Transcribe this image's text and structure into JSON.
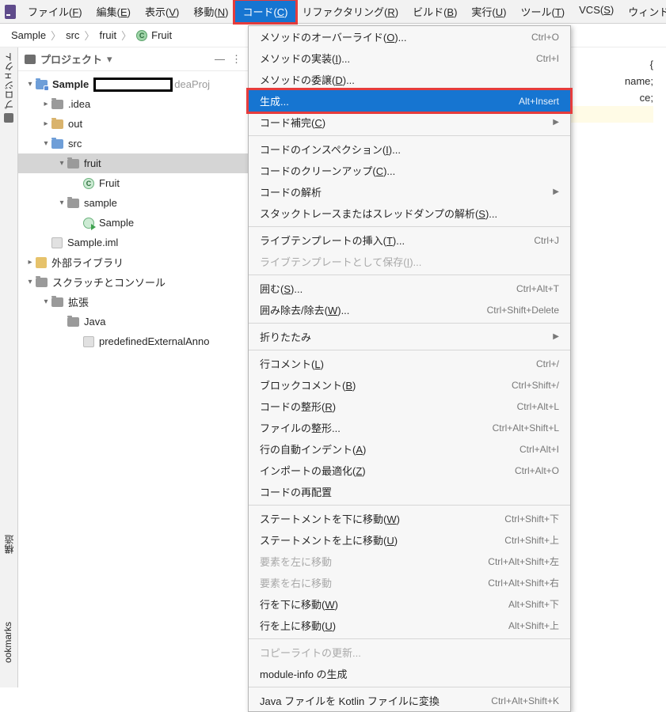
{
  "menubar": {
    "items": [
      {
        "label": "ファイル",
        "mn": "F"
      },
      {
        "label": "編集",
        "mn": "E"
      },
      {
        "label": "表示",
        "mn": "V"
      },
      {
        "label": "移動",
        "mn": "N"
      },
      {
        "label": "コード",
        "mn": "C",
        "active": true
      },
      {
        "label": "リファクタリング",
        "mn": "R"
      },
      {
        "label": "ビルド",
        "mn": "B"
      },
      {
        "label": "実行",
        "mn": "U"
      },
      {
        "label": "ツール",
        "mn": "T"
      },
      {
        "label": "VCS",
        "mn": "S"
      },
      {
        "label": "ウィンドウ",
        "mn": "W"
      }
    ]
  },
  "breadcrumb": {
    "parts": [
      "Sample",
      "src",
      "fruit"
    ],
    "className": "Fruit"
  },
  "sidebar_strip": {
    "project": "プロジェクト",
    "structure": "構造",
    "bookmarks": "ookmarks"
  },
  "tree": {
    "title": "プロジェクト",
    "nodes": {
      "sample": "Sample",
      "sample_tail": "deaProj",
      "idea": ".idea",
      "out": "out",
      "src": "src",
      "fruit": "fruit",
      "fruit_class": "Fruit",
      "sample_pkg": "sample",
      "sample_class": "Sample",
      "iml": "Sample.iml",
      "ext_lib": "外部ライブラリ",
      "scratch": "スクラッチとコンソール",
      "ext": "拡張",
      "java": "Java",
      "pred": "predefinedExternalAnno"
    }
  },
  "editor": {
    "line1_frag": "{",
    "line2_frag": "name;",
    "line3_frag": "ce;"
  },
  "dropdown": {
    "items": [
      {
        "label": "メソッドのオーバーライド",
        "mn": "O",
        "ell": true,
        "sc": "Ctrl+O"
      },
      {
        "label": "メソッドの実装",
        "mn": "I",
        "ell": true,
        "sc": "Ctrl+I"
      },
      {
        "label": "メソッドの委譲",
        "mn": "D",
        "ell": true
      },
      {
        "label": "生成...",
        "sc": "Alt+Insert",
        "sel": true
      },
      {
        "label": "コード補完",
        "mn": "C",
        "sub": true
      },
      {
        "sep": true
      },
      {
        "label": "コードのインスペクション",
        "mn": "I",
        "ell": true
      },
      {
        "label": "コードのクリーンアップ",
        "mn": "C",
        "ell": true
      },
      {
        "label": "コードの解析",
        "sub": true
      },
      {
        "label": "スタックトレースまたはスレッドダンプの解析",
        "mn": "S",
        "ell": true
      },
      {
        "sep": true
      },
      {
        "label": "ライブテンプレートの挿入",
        "mn": "T",
        "ell": true,
        "sc": "Ctrl+J"
      },
      {
        "label": "ライブテンプレートとして保存",
        "mn": "I",
        "ell": true,
        "disabled": true
      },
      {
        "sep": true
      },
      {
        "label": "囲む",
        "mn": "S",
        "ell": true,
        "sc": "Ctrl+Alt+T"
      },
      {
        "label": "囲み除去/除去",
        "mn": "W",
        "ell": true,
        "sc": "Ctrl+Shift+Delete"
      },
      {
        "sep": true
      },
      {
        "label": "折りたたみ",
        "sub": true
      },
      {
        "sep": true
      },
      {
        "label": "行コメント",
        "mn": "L",
        "sc": "Ctrl+/"
      },
      {
        "label": "ブロックコメント",
        "mn": "B",
        "sc": "Ctrl+Shift+/"
      },
      {
        "label": "コードの整形",
        "mn": "R",
        "sc": "Ctrl+Alt+L"
      },
      {
        "label": "ファイルの整形...",
        "sc": "Ctrl+Alt+Shift+L"
      },
      {
        "label": "行の自動インデント",
        "mn": "A",
        "sc": "Ctrl+Alt+I"
      },
      {
        "label": "インポートの最適化",
        "mn": "Z",
        "sc": "Ctrl+Alt+O"
      },
      {
        "label": "コードの再配置"
      },
      {
        "sep": true
      },
      {
        "label": "ステートメントを下に移動",
        "mn": "W",
        "sc": "Ctrl+Shift+下"
      },
      {
        "label": "ステートメントを上に移動",
        "mn": "U",
        "sc": "Ctrl+Shift+上"
      },
      {
        "label": "要素を左に移動",
        "sc": "Ctrl+Alt+Shift+左",
        "disabled": true
      },
      {
        "label": "要素を右に移動",
        "sc": "Ctrl+Alt+Shift+右",
        "disabled": true
      },
      {
        "label": "行を下に移動",
        "mn": "W",
        "sc": "Alt+Shift+下"
      },
      {
        "label": "行を上に移動",
        "mn": "U",
        "sc": "Alt+Shift+上"
      },
      {
        "sep": true
      },
      {
        "label": "コピーライトの更新...",
        "disabled": true
      },
      {
        "label": "module-info の生成"
      },
      {
        "sep": true
      },
      {
        "label": "Java ファイルを Kotlin ファイルに変換",
        "sc": "Ctrl+Alt+Shift+K"
      }
    ]
  }
}
